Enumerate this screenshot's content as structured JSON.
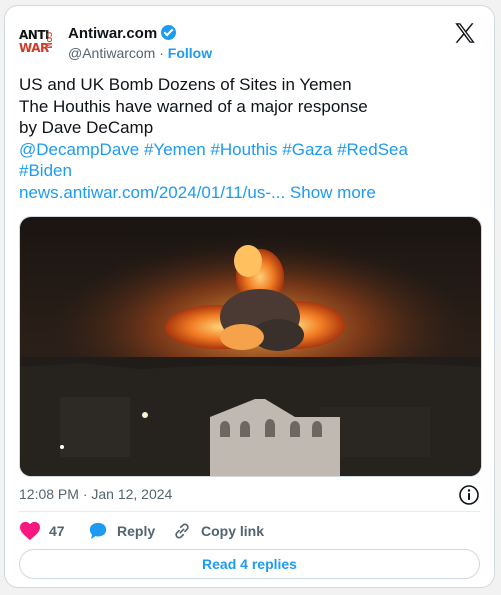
{
  "author": {
    "logo_line1": "ANTI",
    "logo_line2": "WAR",
    "logo_com": ".COM",
    "name": "Antiwar.com",
    "handle": "@Antiwarcom",
    "separator": "·",
    "follow_label": "Follow"
  },
  "tweet": {
    "line1": "US and UK Bomb Dozens of Sites in Yemen",
    "line2": "The Houthis have warned of a major response",
    "line3": "by Dave DeCamp",
    "mentions_line": "@DecampDave #Yemen #Houthis #Gaza #RedSea",
    "hashtag_biden": "#Biden",
    "url": "news.antiwar.com/2024/01/11/us-...",
    "show_more": "Show more"
  },
  "meta": {
    "timestamp": "12:08 PM · Jan 12, 2024"
  },
  "actions": {
    "like_count": "47",
    "reply_label": "Reply",
    "copy_link_label": "Copy link"
  },
  "read_replies_label": "Read 4 replies",
  "colors": {
    "accent": "#1d9bf0",
    "like": "#f91880",
    "muted": "#536471"
  },
  "icons": [
    "verified-badge-icon",
    "x-logo-icon",
    "info-icon",
    "heart-icon",
    "reply-bubble-icon",
    "link-icon"
  ]
}
